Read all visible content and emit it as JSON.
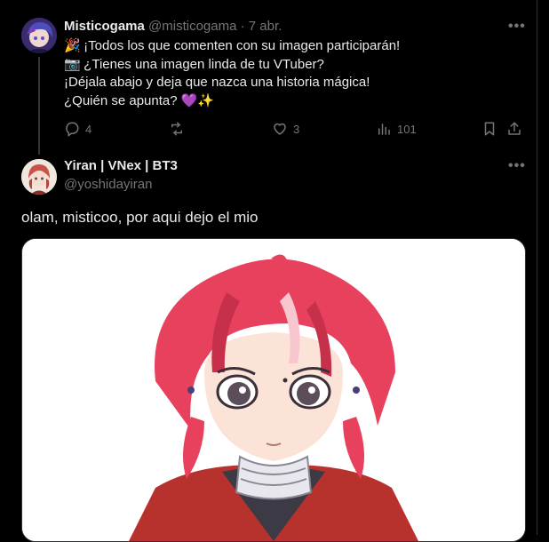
{
  "tweet": {
    "author_name": "Misticogama",
    "handle": "@misticogama",
    "separator": "·",
    "date": "7 abr.",
    "more_label": "•••",
    "lines": [
      {
        "emoji": "🎉",
        "text": "¡Todos los que comenten con su imagen participarán!"
      },
      {
        "emoji": "📷",
        "text": "¿Tienes una imagen linda de tu VTuber?"
      },
      {
        "emoji": "",
        "text": "¡Déjala abajo y deja que nazca una historia mágica!"
      },
      {
        "emoji": "",
        "text": "¿Quién se apunta? 💜✨"
      }
    ],
    "stats": {
      "replies": "4",
      "reposts": "",
      "likes": "3",
      "views": "101"
    }
  },
  "reply": {
    "author_name": "Yiran | VNex | BT3",
    "handle": "@yoshidayiran",
    "more_label": "•••",
    "text": "olam, misticoo, por aqui dejo el mio"
  },
  "colors": {
    "background": "#000000",
    "text": "#e7e9ea",
    "muted": "#71767b",
    "divider": "#2f3336",
    "hair": "#e8415d"
  }
}
